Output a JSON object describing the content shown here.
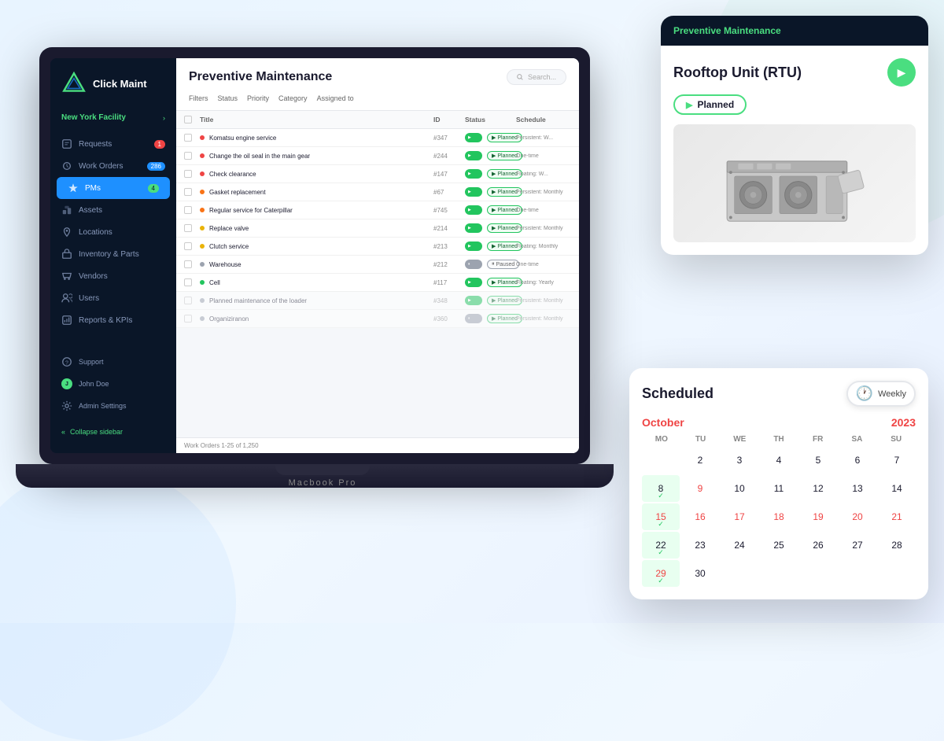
{
  "app": {
    "name": "Click Maint",
    "laptop_label": "Macbook Pro"
  },
  "sidebar": {
    "facility": "New York Facility",
    "nav_items": [
      {
        "label": "Requests",
        "badge": "1",
        "badge_type": "red",
        "icon": "requests"
      },
      {
        "label": "Work Orders",
        "badge": "286",
        "badge_type": "blue",
        "icon": "work-orders"
      },
      {
        "label": "PMs",
        "badge": "4",
        "badge_type": "green",
        "icon": "pms",
        "active": true
      },
      {
        "label": "Assets",
        "icon": "assets"
      },
      {
        "label": "Locations",
        "icon": "locations"
      },
      {
        "label": "Inventory & Parts",
        "icon": "inventory"
      },
      {
        "label": "Vendors",
        "icon": "vendors"
      },
      {
        "label": "Users",
        "icon": "users"
      },
      {
        "label": "Reports & KPIs",
        "icon": "reports"
      }
    ],
    "bottom_items": [
      {
        "label": "Support",
        "icon": "support"
      },
      {
        "label": "John Doe",
        "icon": "user"
      },
      {
        "label": "Admin Settings",
        "icon": "settings"
      }
    ],
    "collapse_label": "Collapse sidebar"
  },
  "main": {
    "title": "Preventive Maintenance",
    "search_placeholder": "Search...",
    "filters": [
      "Filters",
      "Status",
      "Priority",
      "Category",
      "Assigned to"
    ],
    "table_headers": [
      "Title",
      "ID",
      "Status",
      "Schedule"
    ],
    "rows": [
      {
        "title": "Komatsu engine service",
        "id": "#347",
        "status": "Planned",
        "schedule": "Persistent: W...",
        "dot": "red",
        "active": true
      },
      {
        "title": "Change the oil seal in the main gear",
        "id": "#244",
        "status": "Planned",
        "schedule": "One-time",
        "dot": "red",
        "active": true
      },
      {
        "title": "Check clearance",
        "id": "#147",
        "status": "Planned",
        "schedule": "Floating: W...",
        "dot": "red",
        "active": true
      },
      {
        "title": "Gasket replacement",
        "id": "#67",
        "status": "Planned",
        "schedule": "Persistent: Monthly",
        "dot": "orange",
        "active": true
      },
      {
        "title": "Regular service for Caterpillar",
        "id": "#745",
        "status": "Planned",
        "schedule": "One-time",
        "dot": "orange",
        "active": true
      },
      {
        "title": "Replace valve",
        "id": "#214",
        "status": "Planned",
        "schedule": "Persistent: Monthly",
        "dot": "yellow",
        "active": true
      },
      {
        "title": "Clutch service",
        "id": "#213",
        "status": "Planned",
        "schedule": "Floating: Monthly",
        "dot": "yellow",
        "active": true
      },
      {
        "title": "Warehouse",
        "id": "#212",
        "status": "Paused",
        "schedule": "One-time",
        "dot": "gray",
        "active": false
      },
      {
        "title": "Cell",
        "id": "#117",
        "status": "Planned",
        "schedule": "Floating: Yearly",
        "dot": "green",
        "active": true
      },
      {
        "title": "Planned maintenance of the loader",
        "id": "#348",
        "status": "Planned",
        "schedule": "Persistent: Monthly",
        "dot": "gray",
        "active": true,
        "faded": true
      },
      {
        "title": "Organiziranon",
        "id": "#360",
        "status": "Planned",
        "schedule": "Persistent: Monthly",
        "dot": "gray",
        "active": false,
        "faded": true
      }
    ],
    "footer": "Work Orders 1-25 of 1,250"
  },
  "rooftop_card": {
    "header_title": "Preventive Maintenance",
    "asset_name": "Rooftop Unit (RTU)",
    "status": "Planned"
  },
  "calendar": {
    "title": "Scheduled",
    "view": "Weekly",
    "month": "October",
    "year": "2023",
    "days": [
      "MO",
      "TU",
      "WE",
      "TH",
      "FR",
      "SA",
      "SU"
    ],
    "weeks": [
      [
        {
          "num": "",
          "empty": true
        },
        {
          "num": "2",
          "red": false,
          "check": false
        },
        {
          "num": "3",
          "red": false
        },
        {
          "num": "4",
          "red": false
        },
        {
          "num": "5",
          "red": false
        },
        {
          "num": "6",
          "red": false
        },
        {
          "num": "7",
          "red": false
        }
      ],
      [
        {
          "num": "8",
          "check": true,
          "highlighted": true
        },
        {
          "num": "9",
          "red": true
        },
        {
          "num": "10",
          "red": false
        },
        {
          "num": "11",
          "red": false
        },
        {
          "num": "12",
          "red": false
        },
        {
          "num": "13",
          "red": false
        },
        {
          "num": "14",
          "red": false
        }
      ],
      [
        {
          "num": "15",
          "red": true,
          "check": true,
          "highlighted": true
        },
        {
          "num": "16",
          "red": true
        },
        {
          "num": "17",
          "red": true
        },
        {
          "num": "18",
          "red": true
        },
        {
          "num": "19",
          "red": true
        },
        {
          "num": "20",
          "red": true
        },
        {
          "num": "21",
          "red": true
        }
      ],
      [
        {
          "num": "22",
          "red": false,
          "check": true,
          "highlighted": true
        },
        {
          "num": "23",
          "red": false
        },
        {
          "num": "24",
          "red": false
        },
        {
          "num": "25",
          "red": false
        },
        {
          "num": "26",
          "red": false
        },
        {
          "num": "27",
          "red": false
        },
        {
          "num": "28",
          "red": false
        }
      ],
      [
        {
          "num": "29",
          "red": true,
          "check": true,
          "highlighted": true
        },
        {
          "num": "30",
          "red": false
        },
        {
          "num": "",
          "empty": true
        },
        {
          "num": "",
          "empty": true
        },
        {
          "num": "",
          "empty": true
        },
        {
          "num": "",
          "empty": true
        },
        {
          "num": "",
          "empty": true
        }
      ]
    ]
  }
}
